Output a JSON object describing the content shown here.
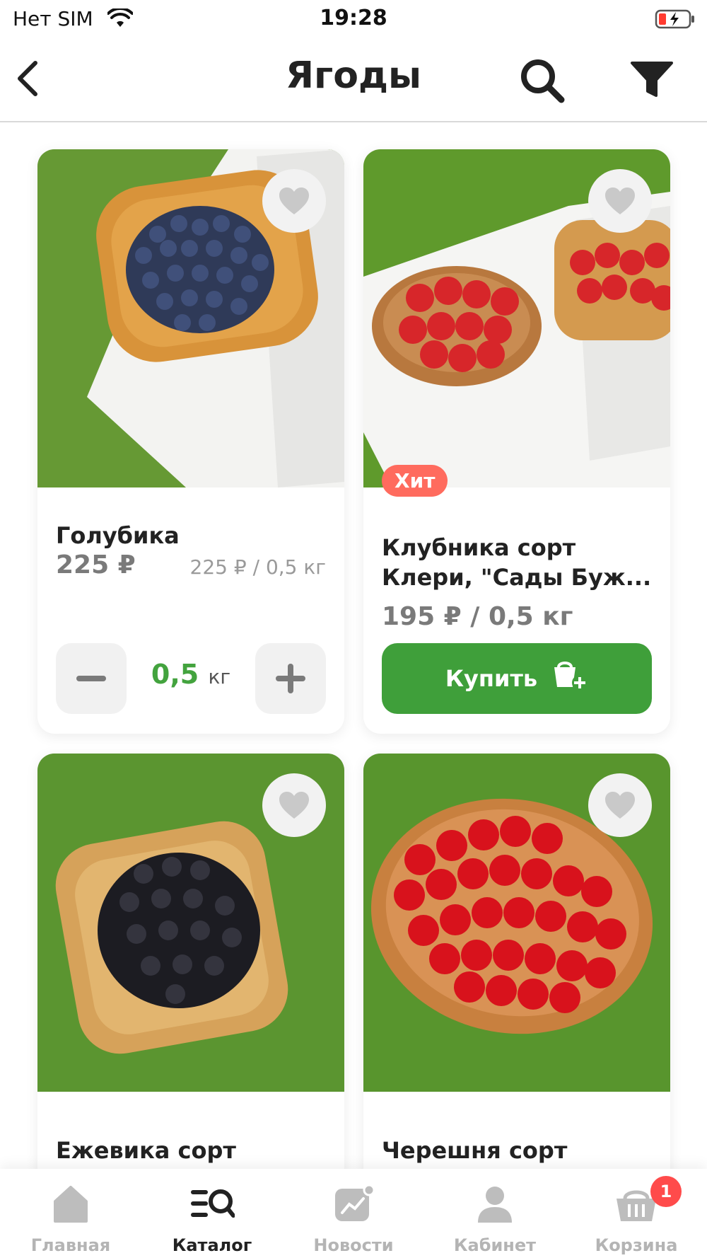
{
  "status_bar": {
    "carrier": "Нет SIM",
    "time": "19:28"
  },
  "header": {
    "title": "Ягоды"
  },
  "products": [
    {
      "name": "Голубика",
      "price": "225 ₽",
      "unit_price": "225 ₽ / 0,5 кг",
      "qty_value": "0,5",
      "qty_unit": "кг"
    },
    {
      "badge": "Хит",
      "name_line1": "Клубника сорт",
      "name_line2": "Клери, \"Сады Буж...",
      "price": "195 ₽ / 0,5 кг",
      "buy_label": "Купить"
    },
    {
      "name": "Ежевика сорт"
    },
    {
      "name": "Черешня сорт"
    }
  ],
  "tabs": [
    {
      "label": "Главная",
      "icon": "home-icon"
    },
    {
      "label": "Каталог",
      "icon": "catalog-icon"
    },
    {
      "label": "Новости",
      "icon": "news-icon"
    },
    {
      "label": "Кабинет",
      "icon": "profile-icon"
    },
    {
      "label": "Корзина",
      "icon": "basket-icon",
      "badge": "1"
    }
  ],
  "colors": {
    "accent_green": "#3f9f3a",
    "badge_red": "#ff6b5e",
    "cart_badge": "#ff4b4b"
  }
}
